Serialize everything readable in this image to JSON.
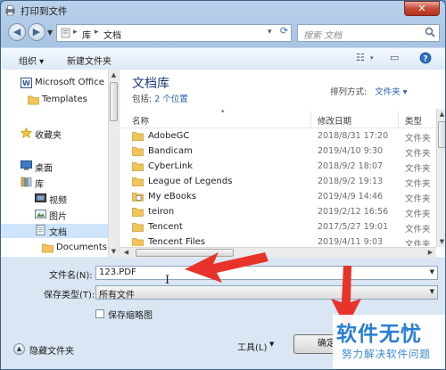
{
  "window": {
    "title": "打印到文件",
    "close_symbol": "✕"
  },
  "address": {
    "segments": [
      "库",
      "文档"
    ],
    "search_placeholder": "搜索 文档"
  },
  "toolbar": {
    "organize": "组织 ▾",
    "new_folder": "新建文件夹"
  },
  "nav": {
    "items": [
      {
        "label": "Microsoft Office",
        "icon": "office-icon"
      },
      {
        "label": "Templates",
        "icon": "folder-icon"
      },
      {
        "label": "收藏夹",
        "icon": "star-icon"
      },
      {
        "label": "桌面",
        "icon": "desktop-icon"
      },
      {
        "label": "库",
        "icon": "library-icon"
      },
      {
        "label": "视频",
        "icon": "video-icon"
      },
      {
        "label": "图片",
        "icon": "picture-icon"
      },
      {
        "label": "文档",
        "icon": "document-icon"
      },
      {
        "label": "Documents",
        "icon": "folder-icon"
      }
    ]
  },
  "content": {
    "library_title": "文档库",
    "includes_label": "包括:",
    "includes_link": "2 个位置",
    "arrange_label": "排列方式:",
    "arrange_value": "文件夹 ▾",
    "columns": {
      "name": "名称",
      "date": "修改日期",
      "type": "类型"
    },
    "files": [
      {
        "name": "AdobeGC",
        "date": "2018/8/31 17:20",
        "type": "文件夹"
      },
      {
        "name": "Bandicam",
        "date": "2019/4/10 9:30",
        "type": "文件夹"
      },
      {
        "name": "CyberLink",
        "date": "2018/9/2 18:07",
        "type": "文件夹"
      },
      {
        "name": "League of Legends",
        "date": "2018/9/2 19:13",
        "type": "文件夹"
      },
      {
        "name": "My eBooks",
        "date": "2019/4/9 14:46",
        "type": "文件夹"
      },
      {
        "name": "teiron",
        "date": "2019/2/12 16:56",
        "type": "文件夹"
      },
      {
        "name": "Tencent",
        "date": "2017/5/27 19:01",
        "type": "文件夹"
      },
      {
        "name": "Tencent Files",
        "date": "2019/4/11 9:03",
        "type": "文件夹"
      }
    ]
  },
  "form": {
    "filename_label": "文件名(N):",
    "filename_value": "123.PDF",
    "filetype_label": "保存类型(T):",
    "filetype_value": "所有文件",
    "thumbnail_label": "保存缩略图",
    "hide_folders": "隐藏文件夹",
    "tools_button": "工具(L)",
    "confirm_button": "确定"
  },
  "watermark": {
    "big": "软件无忧",
    "small": "努力解决软件问题"
  },
  "colors": {
    "annotation_arrow": "#e8332a",
    "watermark": "#2a7fd4",
    "selection": "#cde4fa"
  }
}
